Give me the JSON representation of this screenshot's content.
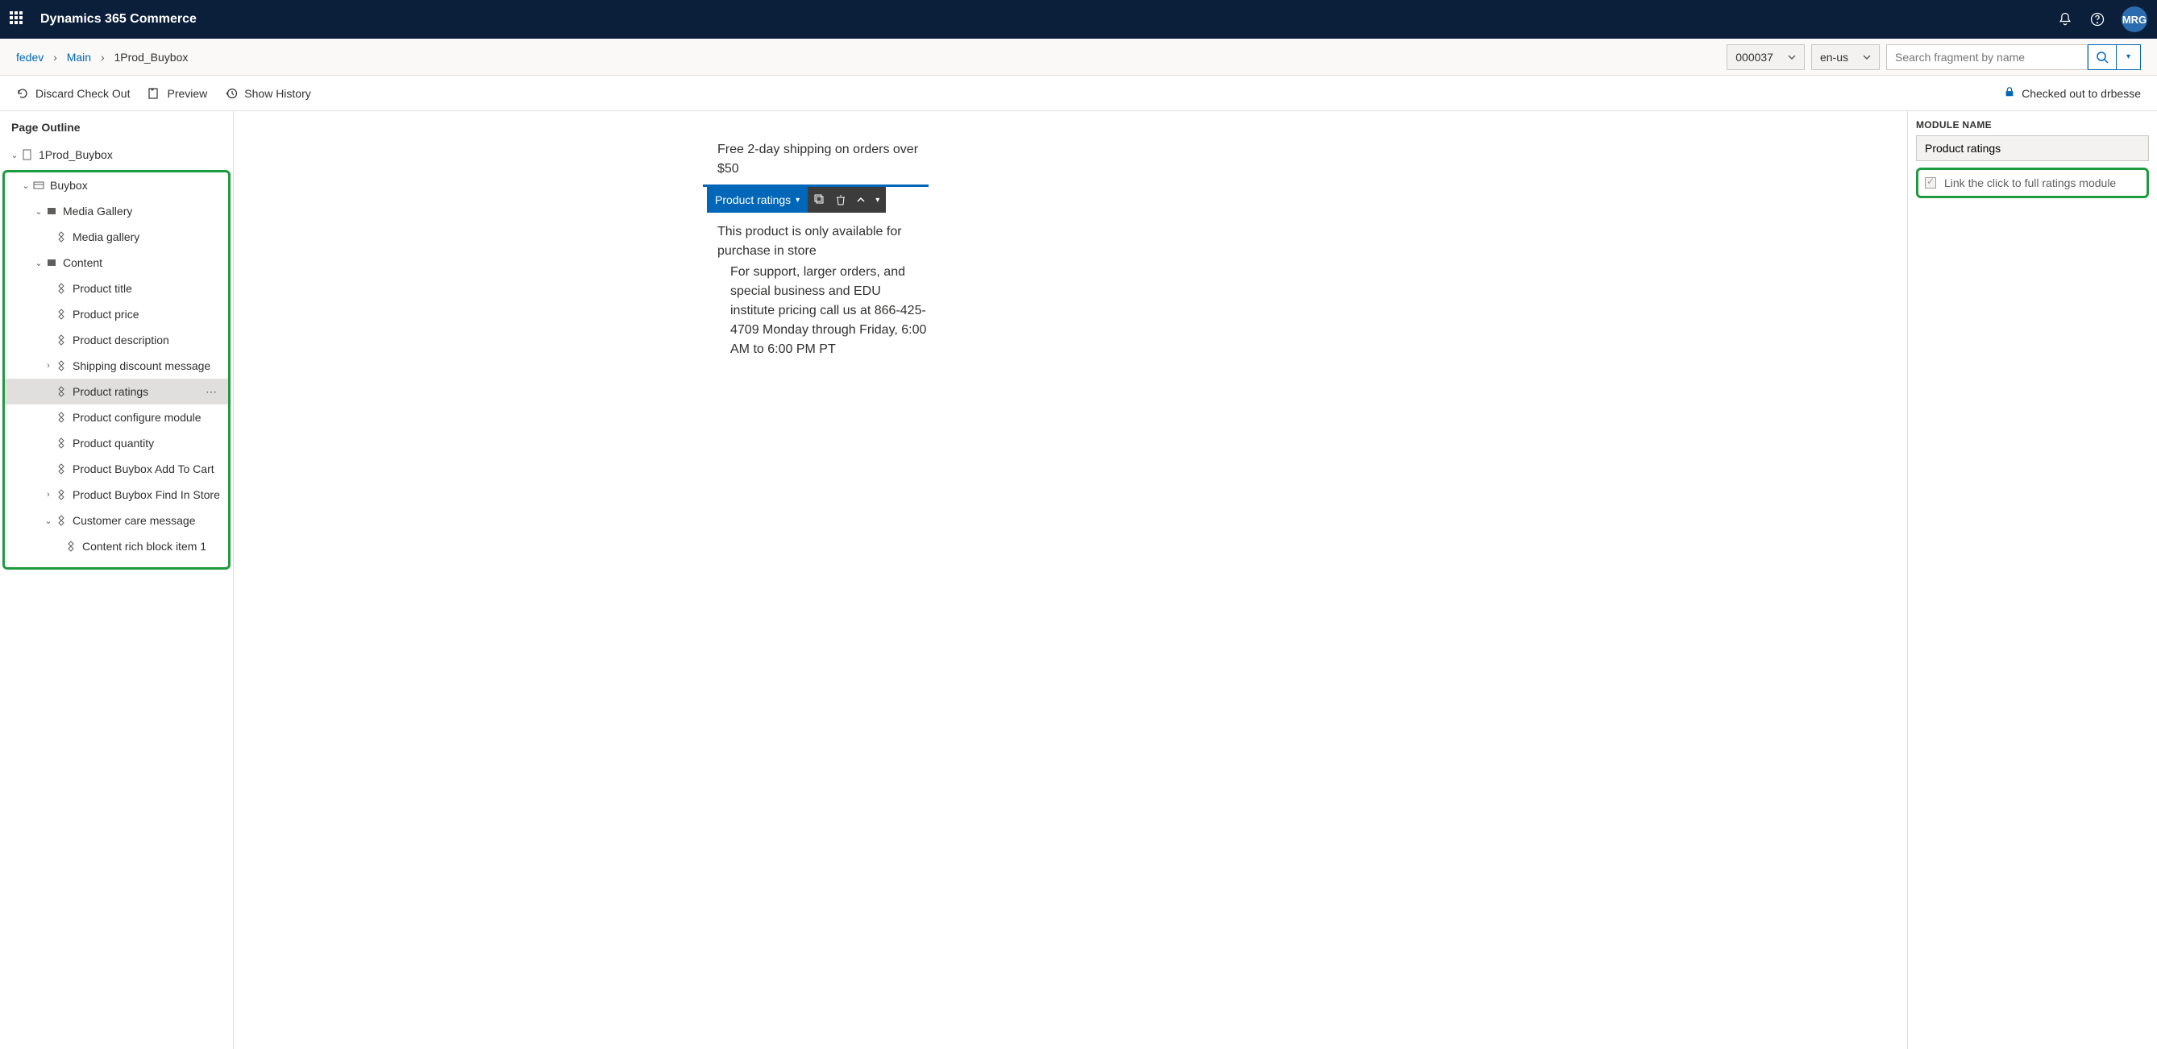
{
  "header": {
    "app_title": "Dynamics 365 Commerce",
    "avatar_initials": "MRG"
  },
  "breadcrumb": {
    "root": "fedev",
    "mid": "Main",
    "current": "1Prod_Buybox",
    "number_dropdown": "000037",
    "locale_dropdown": "en-us",
    "search_placeholder": "Search fragment by name"
  },
  "commands": {
    "discard": "Discard Check Out",
    "preview": "Preview",
    "history": "Show History",
    "checked_out": "Checked out to drbesse"
  },
  "outline": {
    "title": "Page Outline",
    "root": "1Prod_Buybox",
    "buybox": "Buybox",
    "media_gallery_slot": "Media Gallery",
    "media_gallery": "Media gallery",
    "content_slot": "Content",
    "items": {
      "product_title": "Product title",
      "product_price": "Product price",
      "product_description": "Product description",
      "shipping_discount": "Shipping discount message",
      "product_ratings": "Product ratings",
      "configure": "Product configure module",
      "quantity": "Product quantity",
      "add_to_cart": "Product Buybox Add To Cart",
      "find_in_store": "Product Buybox Find In Store",
      "customer_care": "Customer care message",
      "rich_block": "Content rich block item 1"
    }
  },
  "canvas": {
    "free_shipping": "Free 2-day shipping on orders over $50",
    "module_chip": "Product ratings",
    "store_only": "This product is only available for purchase in store",
    "support": "For support, larger orders, and special business and EDU institute pricing call us at 866-425-4709 Monday through Friday, 6:00 AM to 6:00 PM PT"
  },
  "properties": {
    "section_label": "MODULE NAME",
    "module_name_value": "Product ratings",
    "checkbox_label": "Link the click to full ratings module"
  }
}
